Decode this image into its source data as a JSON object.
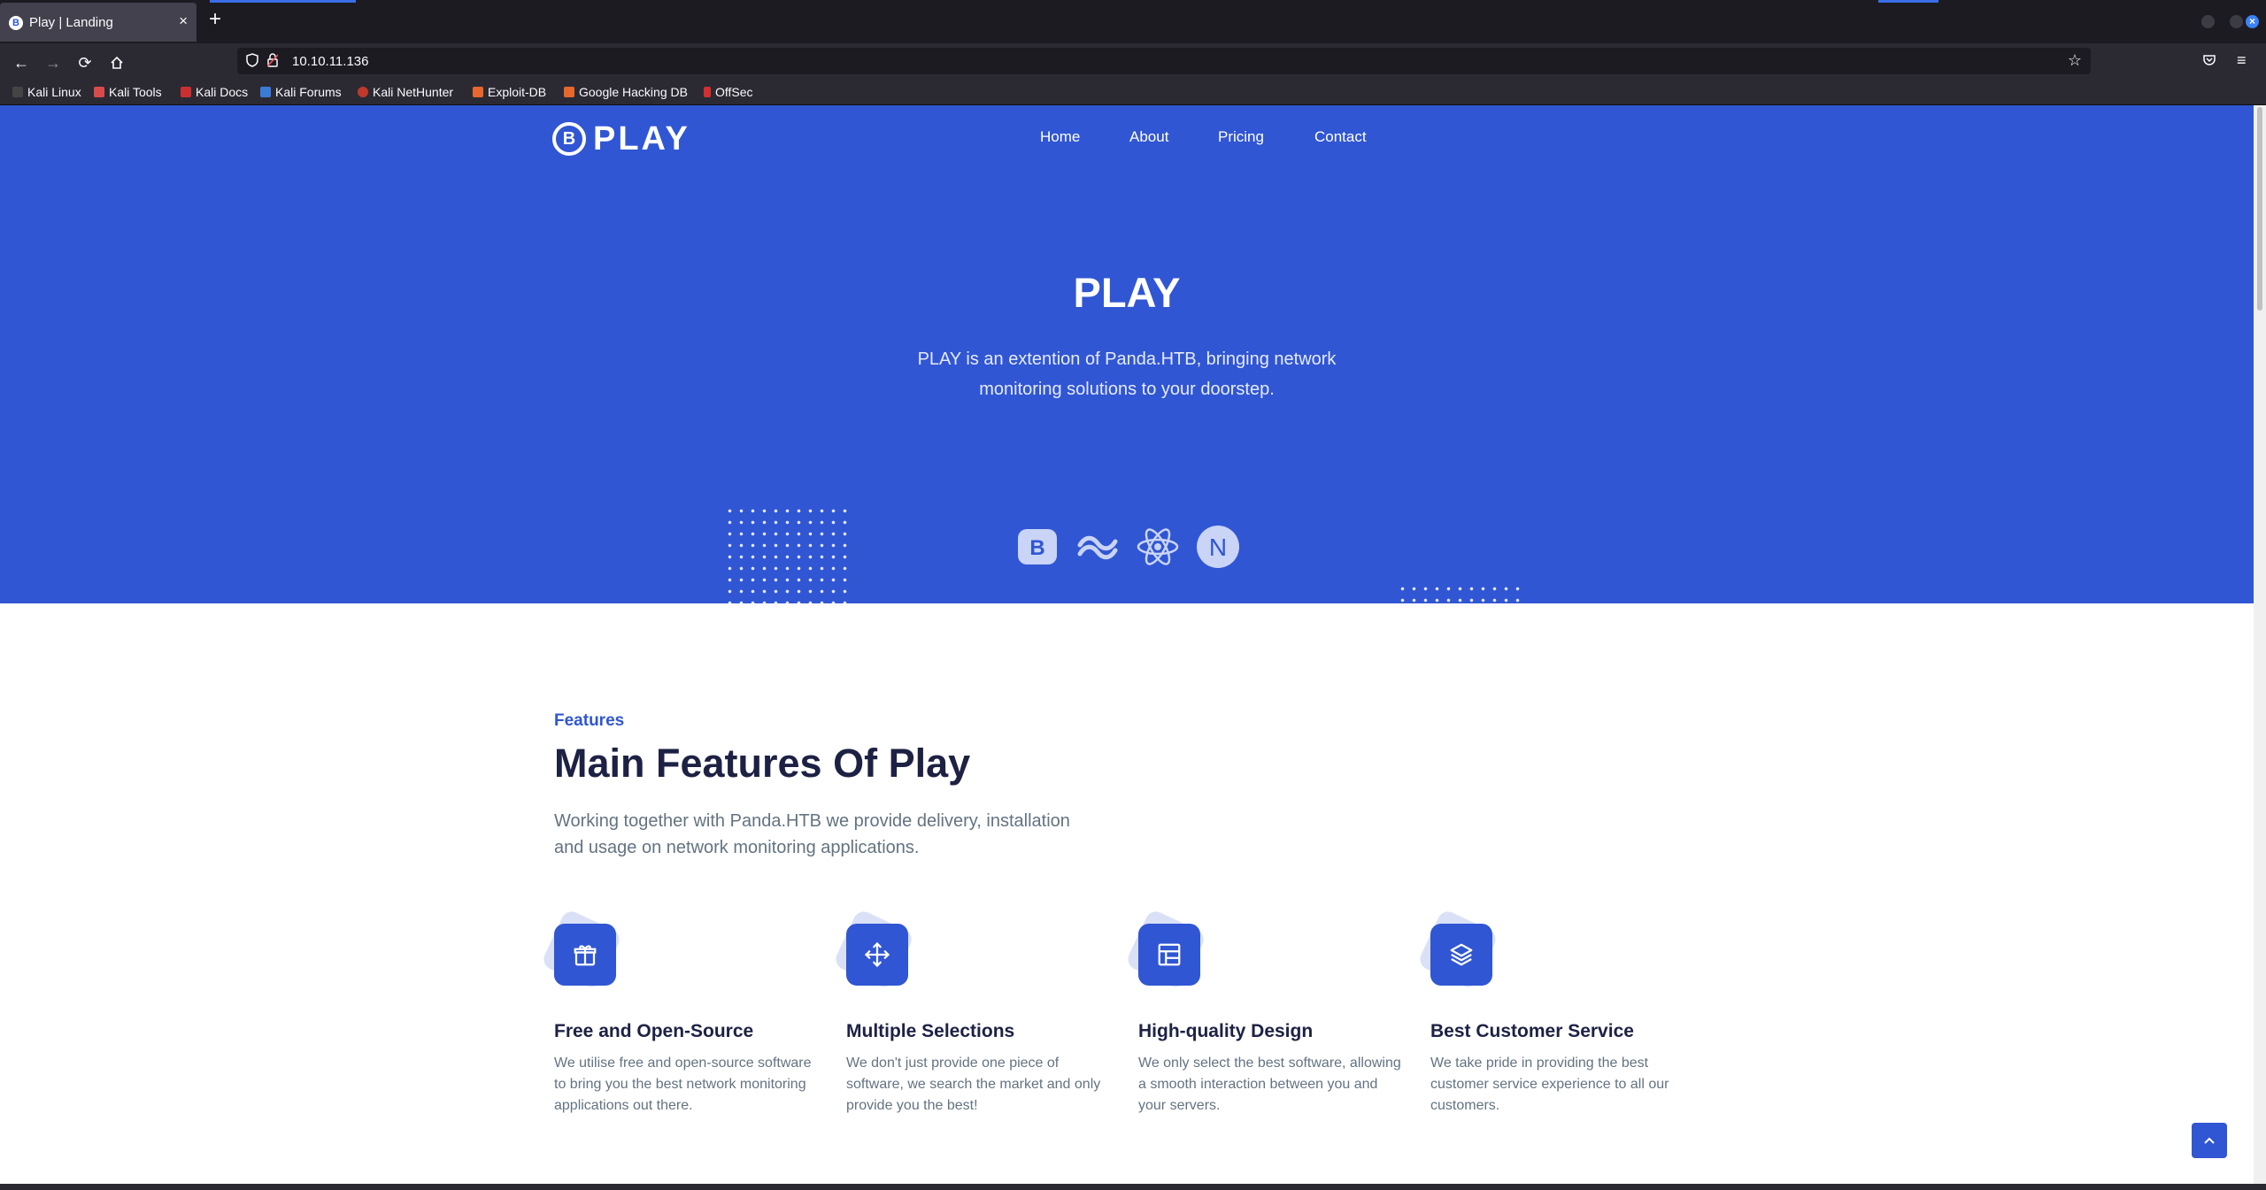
{
  "browser": {
    "tab_title": "Play | Landing",
    "tab_close": "×",
    "new_tab": "+",
    "url": "10.10.11.136",
    "bookmarks": [
      "Kali Linux",
      "Kali Tools",
      "Kali Docs",
      "Kali Forums",
      "Kali NetHunter",
      "Exploit-DB",
      "Google Hacking DB",
      "OffSec"
    ]
  },
  "site": {
    "logo_mark": "B",
    "logo_text": "PLAY",
    "nav": [
      "Home",
      "About",
      "Pricing",
      "Contact"
    ]
  },
  "hero": {
    "title": "PLAY",
    "subtitle": "PLAY is an extention of Panda.HTB, bringing network monitoring solutions to your doorstep.",
    "tech_icons": [
      "bootstrap-icon",
      "tailwind-icon",
      "react-icon",
      "nextjs-icon"
    ],
    "tech_letters": {
      "bootstrap": "B",
      "next": "N"
    }
  },
  "features": {
    "eyebrow": "Features",
    "title": "Main Features Of Play",
    "description": "Working together with Panda.HTB we provide delivery, installation and usage on network monitoring applications.",
    "items": [
      {
        "icon": "gift-icon",
        "title": "Free and Open-Source",
        "text": "We utilise free and open-source software to bring you the best network monitoring applications out there."
      },
      {
        "icon": "move-arrows-icon",
        "title": "Multiple Selections",
        "text": "We don't just provide one piece of software, we search the market and only provide you the best!"
      },
      {
        "icon": "layout-icon",
        "title": "High-quality Design",
        "text": "We only select the best software, allowing a smooth interaction between you and your servers."
      },
      {
        "icon": "layers-icon",
        "title": "Best Customer Service",
        "text": "We take pride in providing the best customer service experience to all our customers."
      }
    ]
  },
  "colors": {
    "primary": "#3056d3",
    "heading": "#1d2144",
    "body": "#637381"
  }
}
